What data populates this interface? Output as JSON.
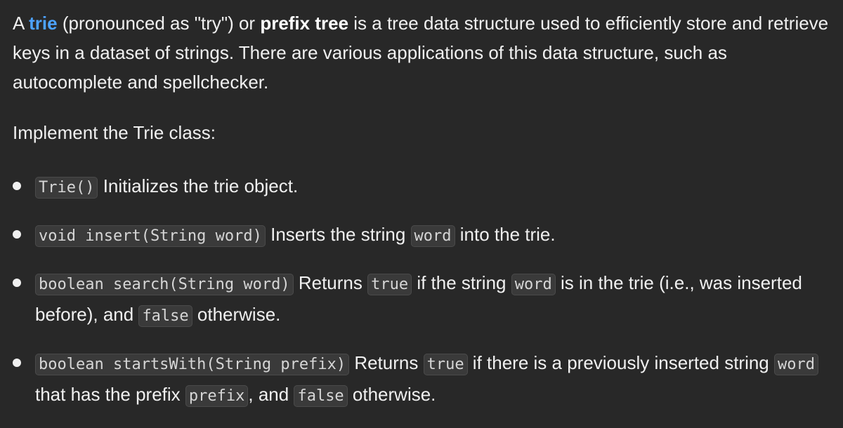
{
  "intro": {
    "part1": "A ",
    "link": "trie",
    "part2": " (pronounced as \"try\") or ",
    "bold": "prefix tree",
    "part3": " is a tree data structure used to efficiently store and retrieve keys in a dataset of strings. There are various applications of this data structure, such as autocomplete and spellchecker."
  },
  "implement": "Implement the Trie class:",
  "items": [
    {
      "code": "Trie()",
      "text1": " Initializes the trie object."
    },
    {
      "code": "void insert(String word)",
      "text1": " Inserts the string ",
      "code2": "word",
      "text2": " into the trie."
    },
    {
      "code": "boolean search(String word)",
      "text1": " Returns ",
      "code2": "true",
      "text2": " if the string ",
      "code3": "word",
      "text3": " is in the trie (i.e., was inserted before), and ",
      "code4": "false",
      "text4": " otherwise."
    },
    {
      "code": "boolean startsWith(String prefix)",
      "text1": " Returns ",
      "code2": "true",
      "text2": " if there is a previously inserted string ",
      "code3": "word",
      "text3": " that has the prefix ",
      "code4": "prefix",
      "text4": ", and ",
      "code5": "false",
      "text5": " otherwise."
    }
  ],
  "colors": {
    "background": "#282828",
    "text": "#f0f0f0",
    "link": "#4da3ff",
    "code_bg": "#3a3a3a"
  }
}
